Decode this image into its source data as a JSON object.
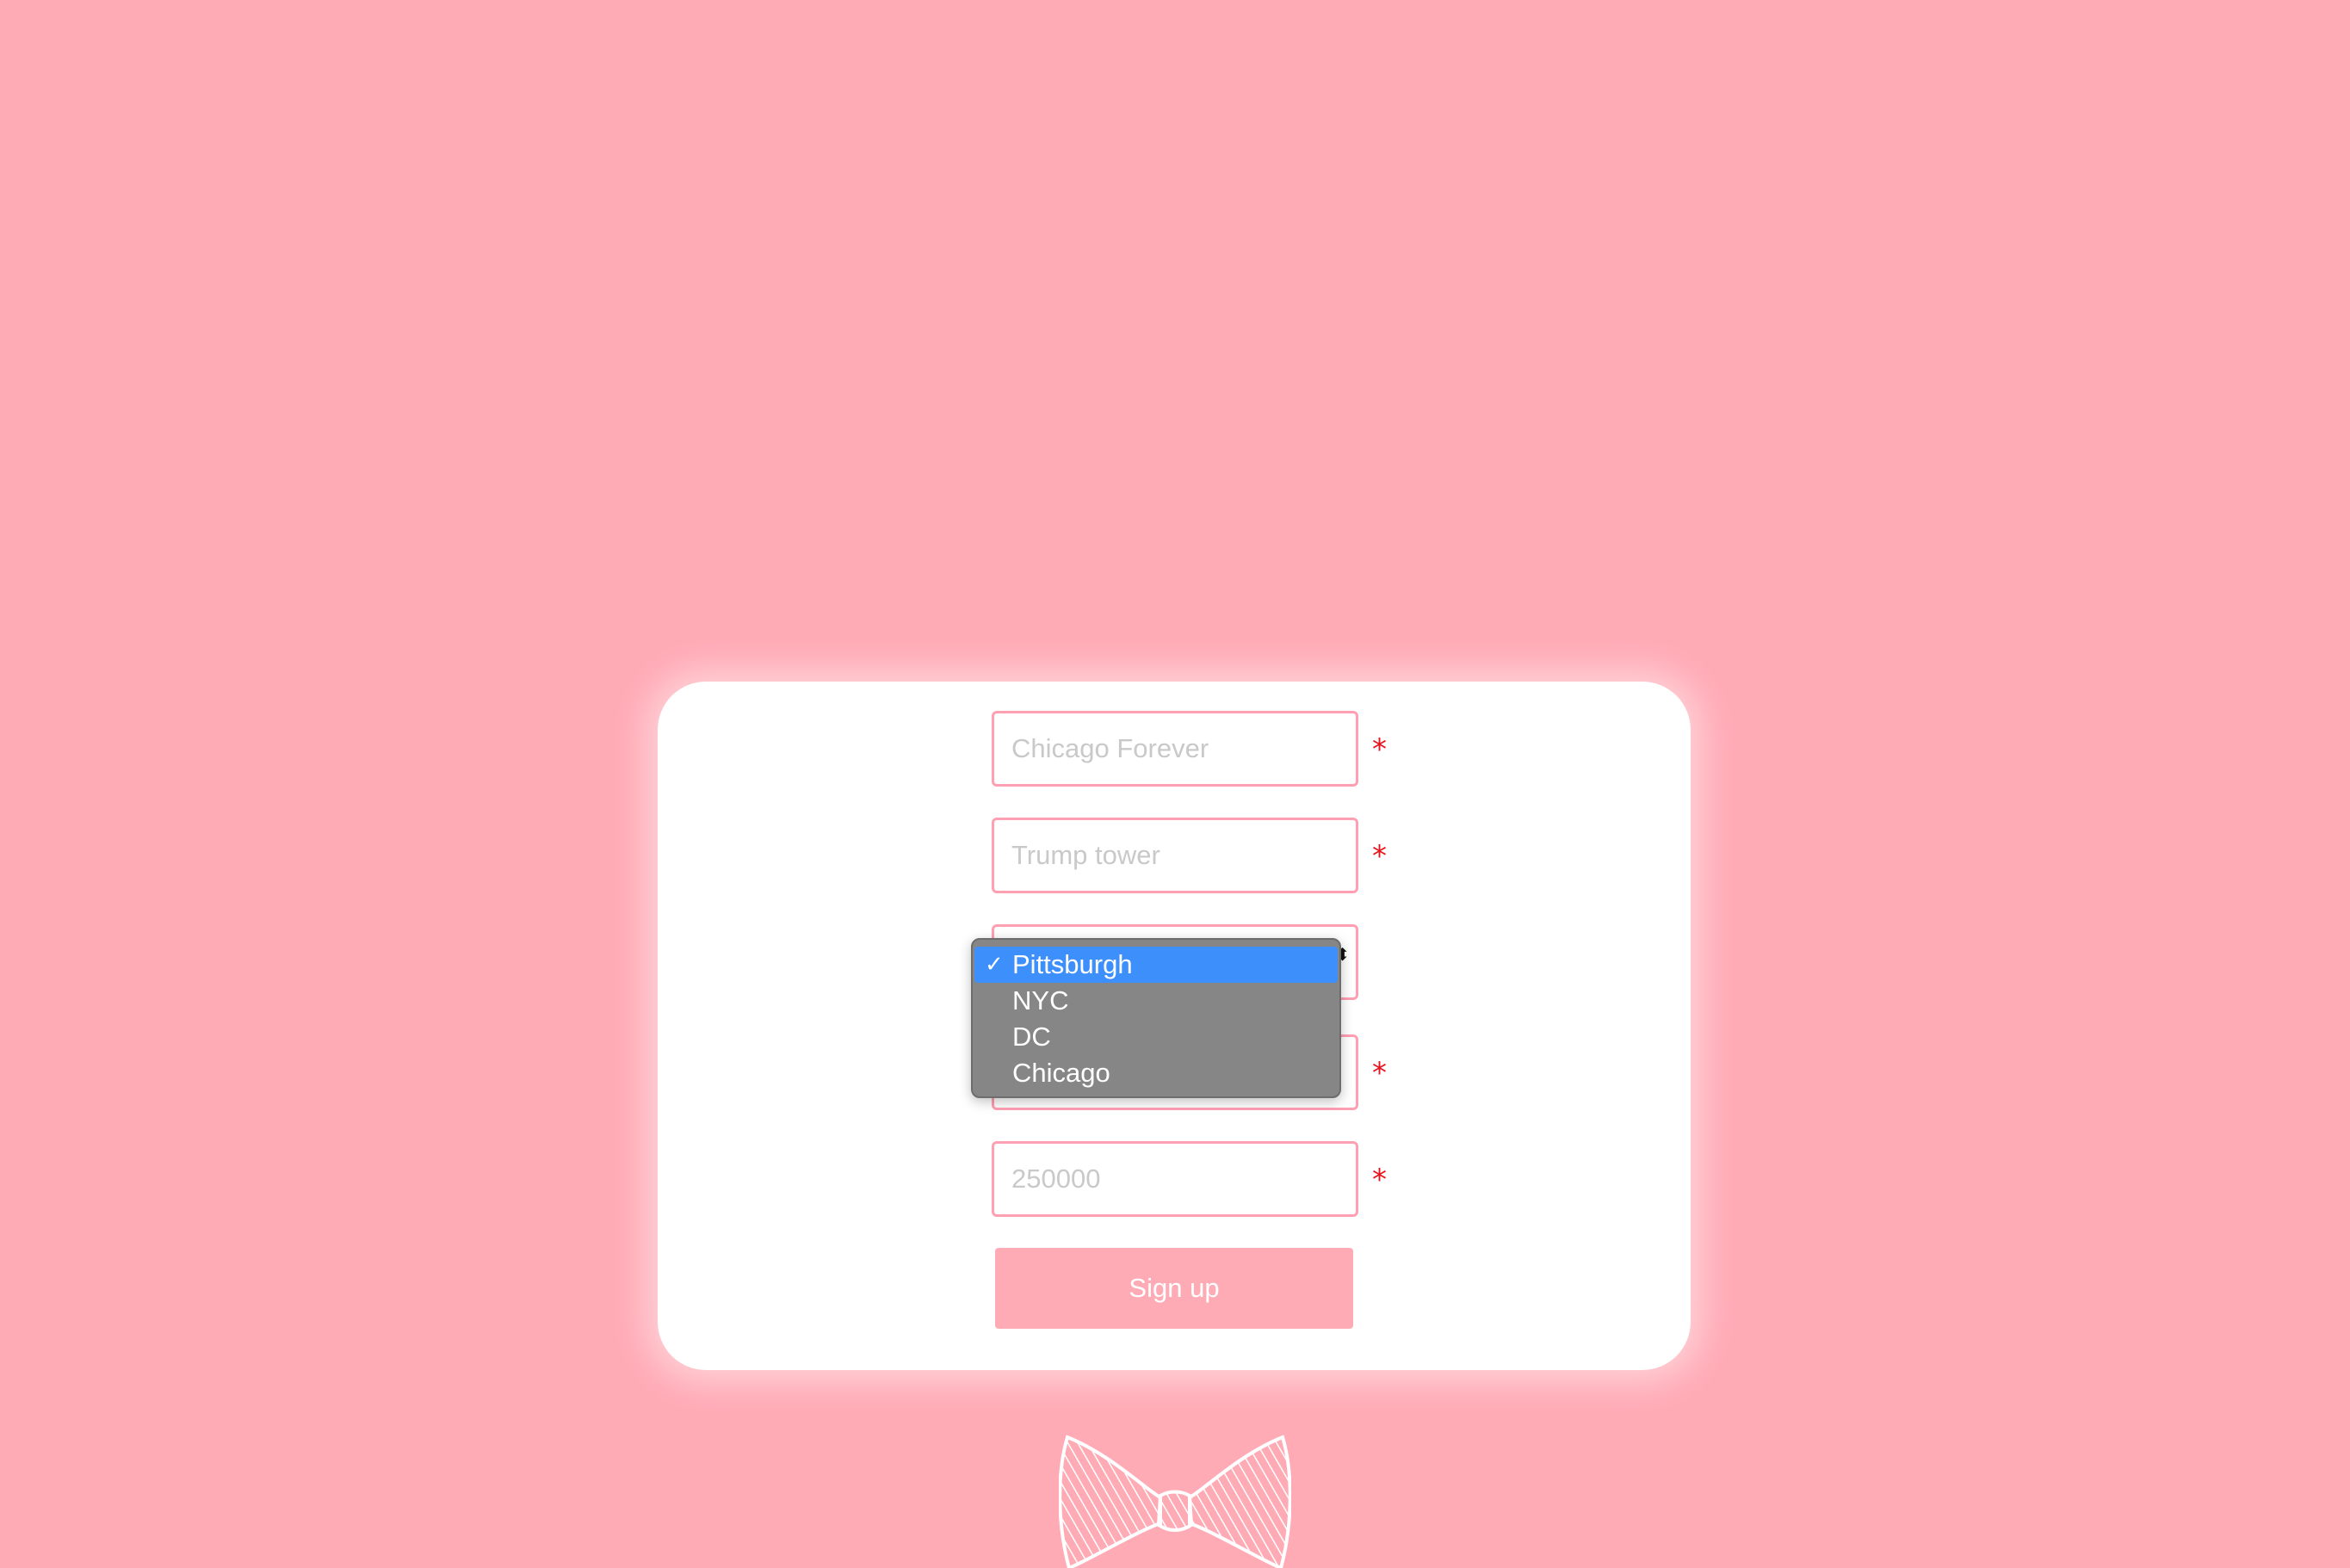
{
  "form": {
    "field1": {
      "placeholder": "Chicago Forever",
      "required_mark": "*"
    },
    "field2": {
      "placeholder": "Trump tower",
      "required_mark": "*"
    },
    "city_select": {
      "arrows": "⬍",
      "options": [
        {
          "label": "Pittsburgh",
          "selected": true,
          "check": "✓"
        },
        {
          "label": "NYC",
          "selected": false
        },
        {
          "label": "DC",
          "selected": false
        },
        {
          "label": "Chicago",
          "selected": false
        }
      ]
    },
    "field4": {
      "placeholder": "",
      "required_mark": "*"
    },
    "field5": {
      "placeholder": "250000",
      "required_mark": "*"
    },
    "submit_label": "Sign up"
  },
  "colors": {
    "background": "#ffabb6",
    "card": "#ffffff",
    "input_border": "#ff9fb2",
    "required": "#e8141d",
    "dropdown_bg": "#878686",
    "selected_option": "#3d8ffb"
  },
  "decor": {
    "logo_icon": "bowtie-icon"
  }
}
